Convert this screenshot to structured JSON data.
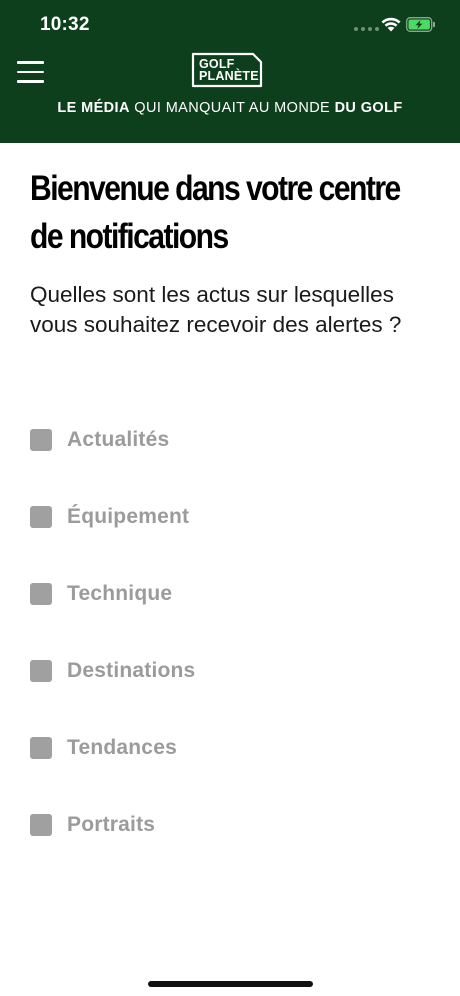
{
  "status_bar": {
    "time": "10:32",
    "signal_icon": "cellular-signal-icon",
    "wifi_icon": "wifi-icon",
    "battery_icon": "battery-charging-icon",
    "battery_color": "#4cd964"
  },
  "header": {
    "background_color": "#0d3f1d",
    "menu_icon": "hamburger-menu-icon",
    "logo": {
      "line1": "GOLF",
      "line2": "PLANÈTE"
    },
    "tagline": {
      "part1": "LE MÉDIA",
      "part2": " QUI MANQUAIT AU MONDE ",
      "part3": "DU GOLF"
    }
  },
  "main": {
    "title": "Bienvenue dans votre centre de notifications",
    "subtitle": "Quelles sont les actus sur lesquelles vous souhaitez recevoir des alertes ?"
  },
  "topics": [
    {
      "label": "Actualités",
      "checked": false
    },
    {
      "label": "Équipement",
      "checked": false
    },
    {
      "label": "Technique",
      "checked": false
    },
    {
      "label": "Destinations",
      "checked": false
    },
    {
      "label": "Tendances",
      "checked": false
    },
    {
      "label": "Portraits",
      "checked": false
    }
  ]
}
